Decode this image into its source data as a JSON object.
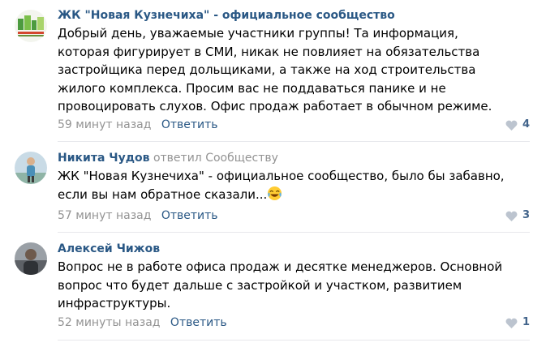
{
  "comments": [
    {
      "author": "ЖК \"Новая Кузнечиха\" - официальное сообщество",
      "text": "Добрый день, уважаемые участники группы! Та информация, которая фигурирует в СМИ, никак не повлияет на обязательства застройщика перед дольщиками, а также на ход строительства жилого комплекса. Просим вас не поддаваться панике и не провоцировать слухов. Офис продаж работает в обычном режиме.",
      "time": "59 минут назад",
      "reply_label": "Ответить",
      "likes": "4",
      "avatar_text": "НОВАЯ КУЗНЕЧИХА"
    },
    {
      "author": "Никита Чудов",
      "reply_to": "ответил Сообществу",
      "text": "ЖК \"Новая Кузнечиха\" - официальное сообщество, было бы забавно, если вы нам обратное сказали...",
      "emoji": "laughing-with-tears-emoji",
      "time": "57 минут назад",
      "reply_label": "Ответить",
      "likes": "3"
    },
    {
      "author": "Алексей Чижов",
      "text": "Вопрос не в работе офиса продаж и десятке менеджеров. Основной вопрос что будет дальше с застройкой и участком, развитием инфраструктуры.",
      "time": "52 минуты назад",
      "reply_label": "Ответить",
      "likes": "1"
    }
  ],
  "colors": {
    "link": "#2a5885",
    "meta": "#939393",
    "divider": "#e7e8ec",
    "like_icon": "#bcc4cf"
  }
}
